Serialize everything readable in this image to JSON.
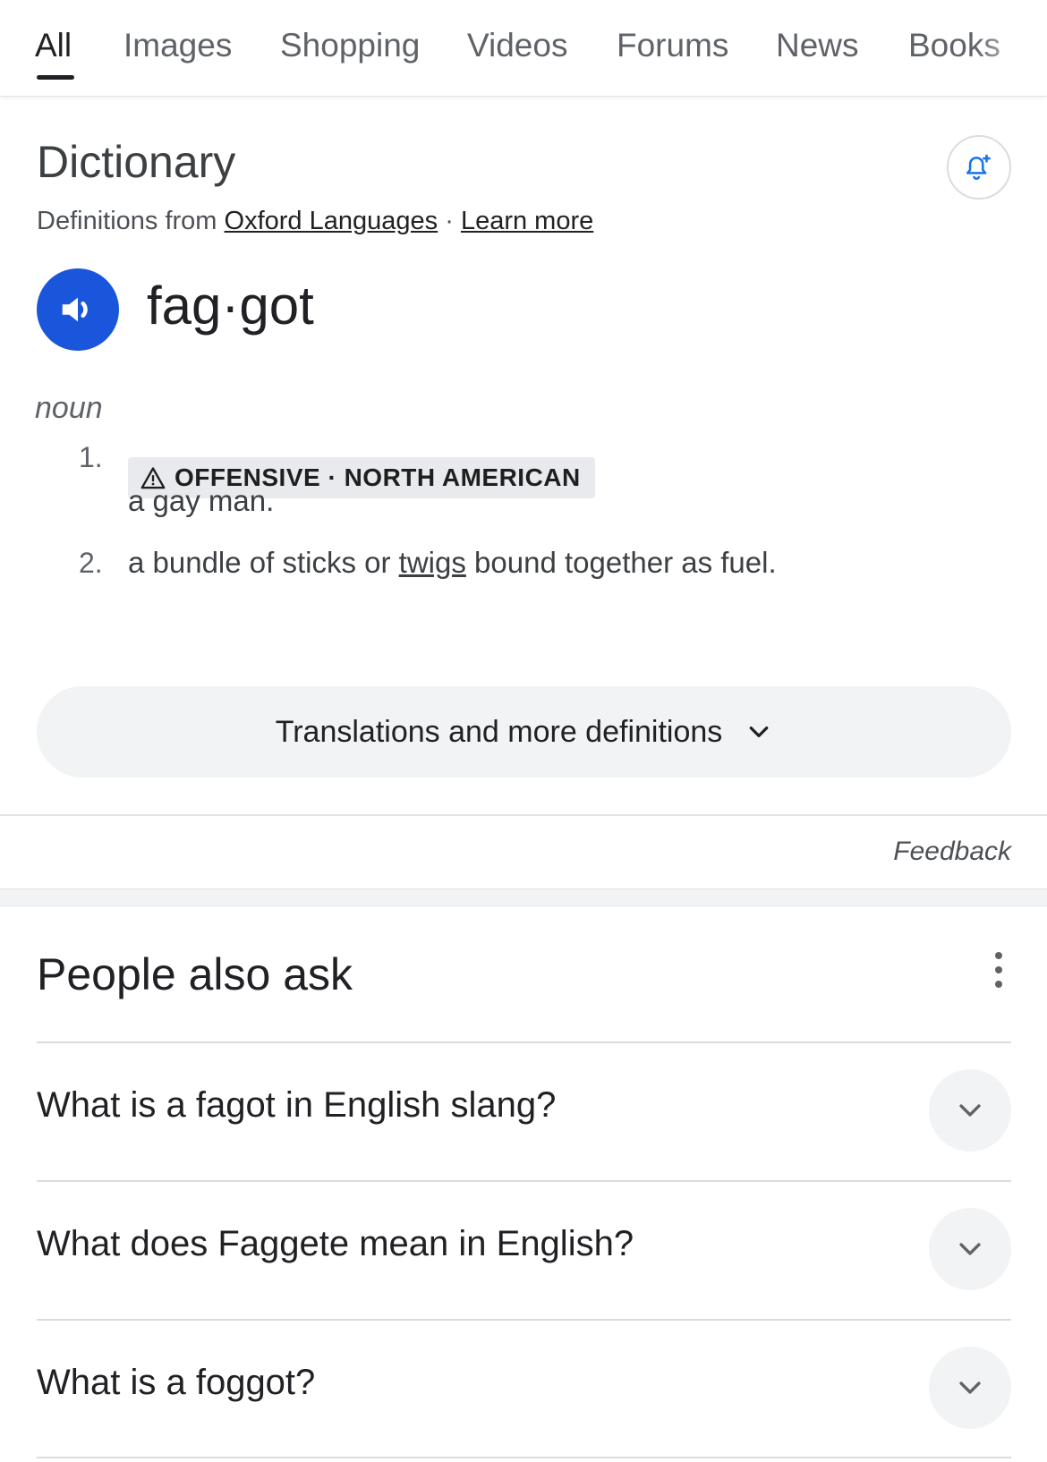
{
  "tabs": [
    {
      "label": "All",
      "active": true
    },
    {
      "label": "Images"
    },
    {
      "label": "Shopping"
    },
    {
      "label": "Videos"
    },
    {
      "label": "Forums"
    },
    {
      "label": "News"
    },
    {
      "label": "Books"
    }
  ],
  "dictionary": {
    "title": "Dictionary",
    "source_prefix": "Definitions from",
    "source_link": "Oxford Languages",
    "separator": "·",
    "learn_more": "Learn more",
    "alert_icon": "add-alert-bell-icon",
    "speaker_icon": "volume-speaker-icon",
    "headword": "fag·got",
    "part_of_speech": "noun",
    "definitions": [
      {
        "number": "1.",
        "badge_icon": "warning-triangle-icon",
        "badge": "OFFENSIVE · NORTH AMERICAN",
        "text": "a gay man."
      },
      {
        "number": "2.",
        "text_before": "a bundle of sticks or",
        "link": "twigs",
        "text_after": "bound together as fuel."
      }
    ],
    "more_button": "Translations and more definitions",
    "feedback": "Feedback"
  },
  "people_also_ask": {
    "title": "People also ask",
    "menu_icon": "more-vert-icon",
    "questions": [
      "What is a fagot in English slang?",
      "What does Faggete mean in English?",
      "What is a foggot?"
    ]
  },
  "colors": {
    "speaker_bg": "#1a56db",
    "alert_icon": "#1a73e8",
    "badge_bg": "#e8eaed",
    "chip_bg": "#f1f3f4"
  }
}
